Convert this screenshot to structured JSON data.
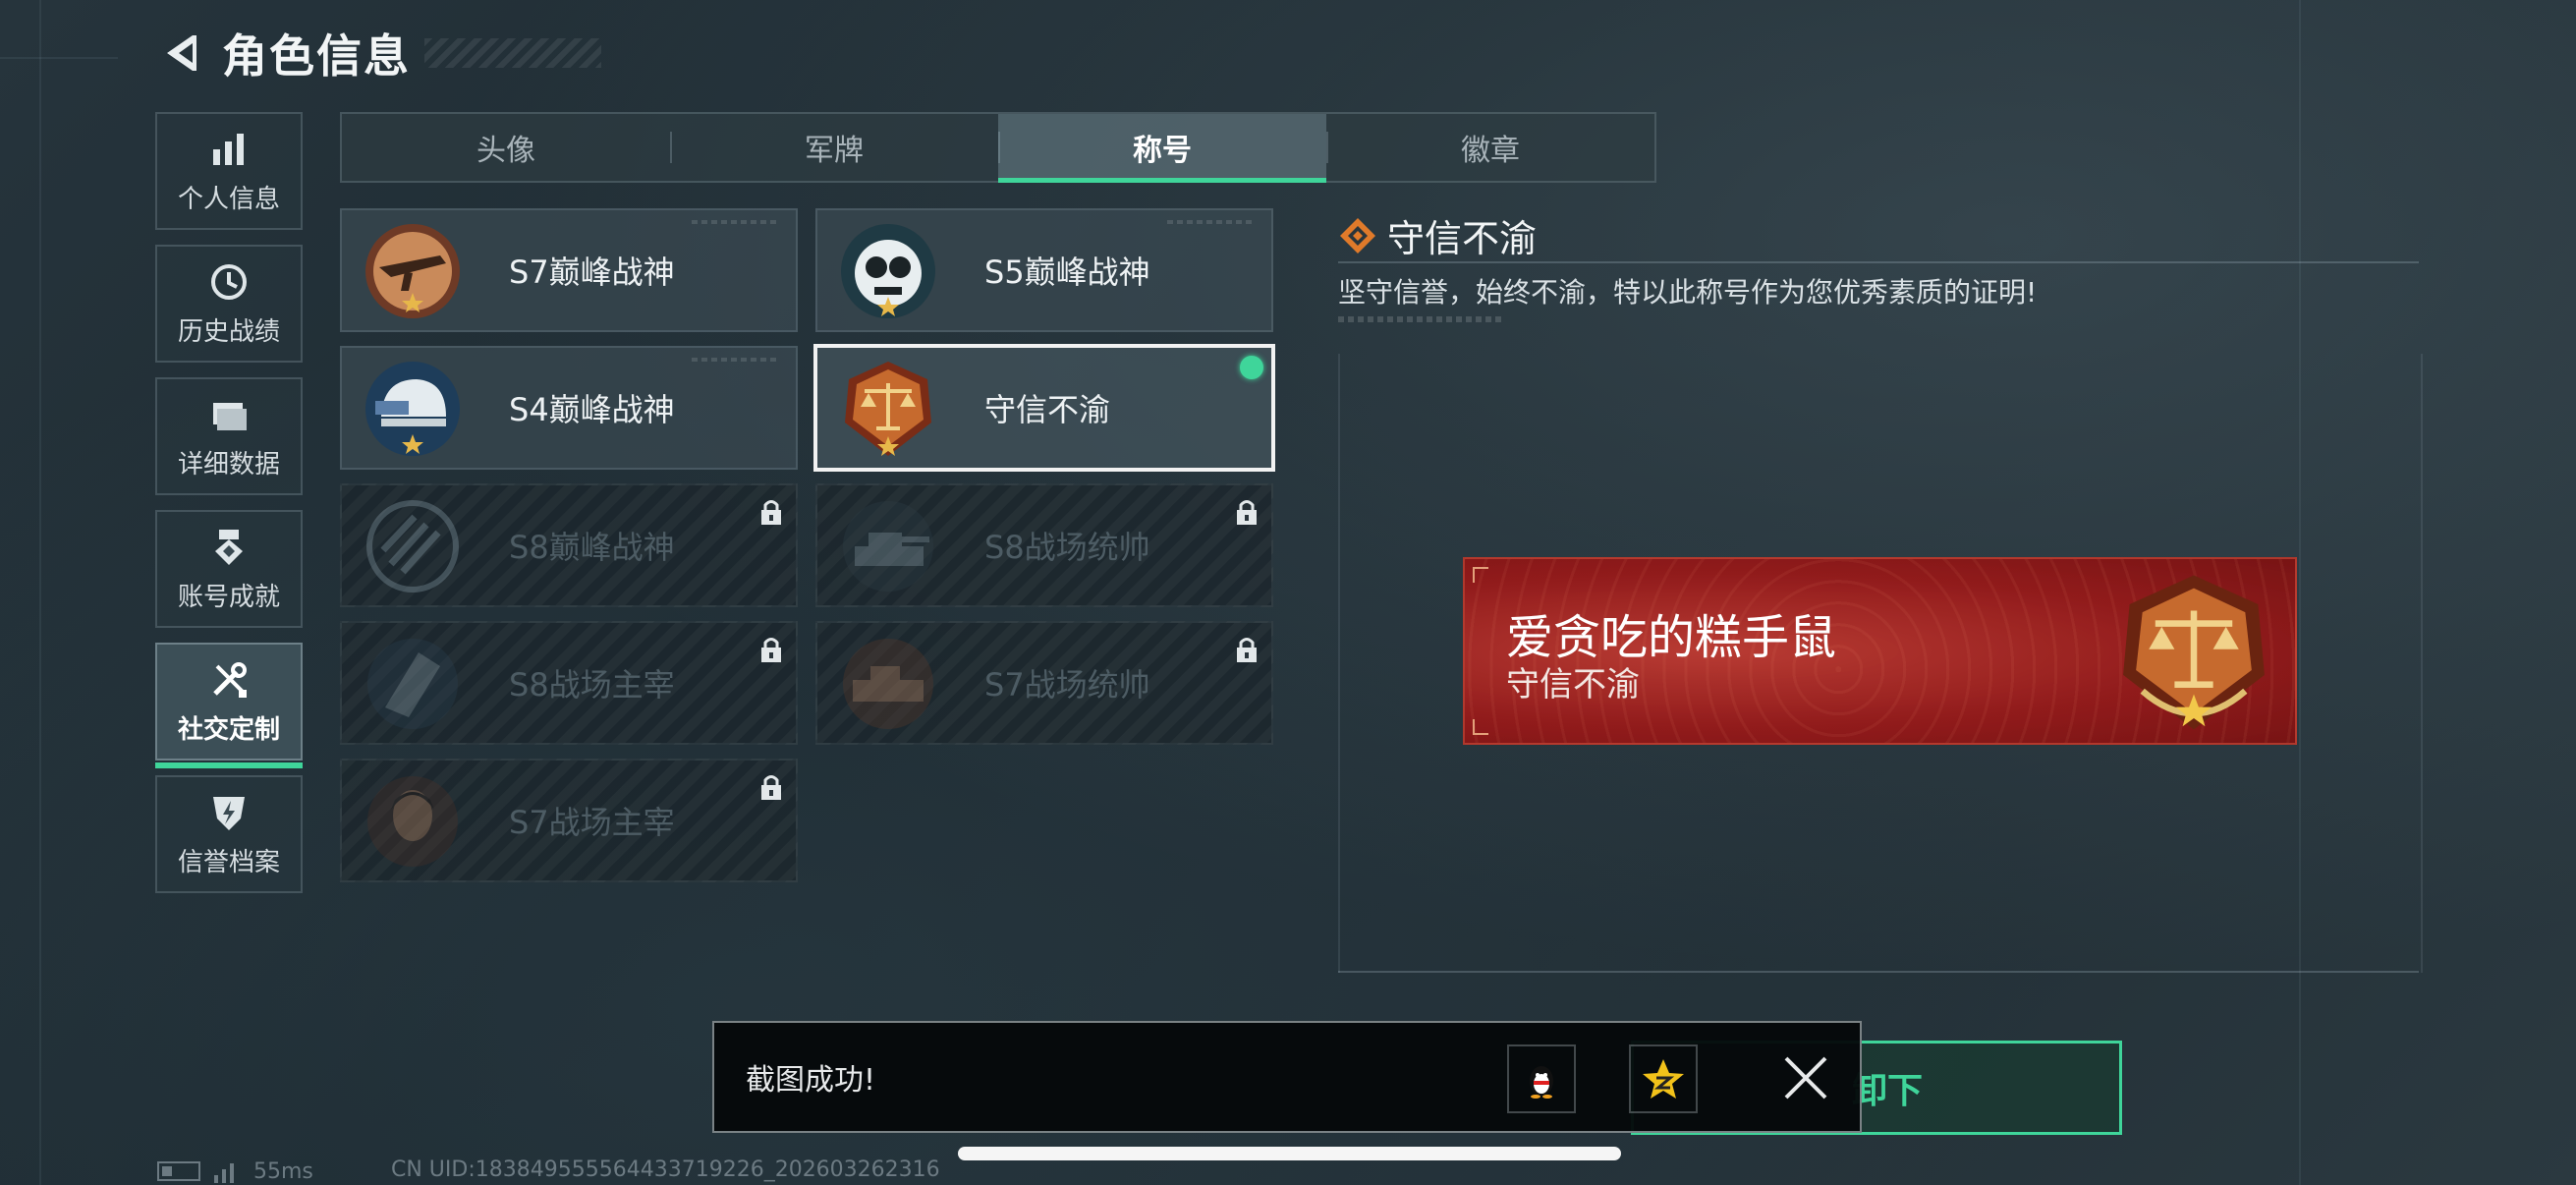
{
  "header": {
    "title": "角色信息"
  },
  "sidebar": {
    "items": [
      {
        "label": "个人信息"
      },
      {
        "label": "历史战绩"
      },
      {
        "label": "详细数据"
      },
      {
        "label": "账号成就"
      },
      {
        "label": "社交定制"
      },
      {
        "label": "信誉档案"
      }
    ],
    "active_index": 4
  },
  "tabs": [
    {
      "label": "头像"
    },
    {
      "label": "军牌"
    },
    {
      "label": "称号"
    },
    {
      "label": "徽章"
    }
  ],
  "active_tab_index": 2,
  "titles": [
    {
      "label": "S7巅峰战神",
      "locked": false
    },
    {
      "label": "S5巅峰战神",
      "locked": false
    },
    {
      "label": "S4巅峰战神",
      "locked": false
    },
    {
      "label": "守信不渝",
      "locked": false,
      "selected": true,
      "equipped": true
    },
    {
      "label": "S8巅峰战神",
      "locked": true
    },
    {
      "label": "S8战场统帅",
      "locked": true
    },
    {
      "label": "S8战场主宰",
      "locked": true
    },
    {
      "label": "S7战场统帅",
      "locked": true
    },
    {
      "label": "S7战场主宰",
      "locked": true
    }
  ],
  "detail": {
    "title": "守信不渝",
    "description": "坚守信誉，始终不渝，特以此称号作为您优秀素质的证明!"
  },
  "banner": {
    "player_name": "爱贪吃的糕手鼠",
    "title": "守信不渝"
  },
  "toast": {
    "message": "截图成功!"
  },
  "unequip": {
    "label": "卸下"
  },
  "status": {
    "ping": "55ms",
    "uid": "CN UID:1838495555644337192​26_202603262316"
  },
  "colors": {
    "accent_green": "#3fd59a",
    "banner_red": "#a8221e",
    "badge_orange": "#d2691e"
  }
}
